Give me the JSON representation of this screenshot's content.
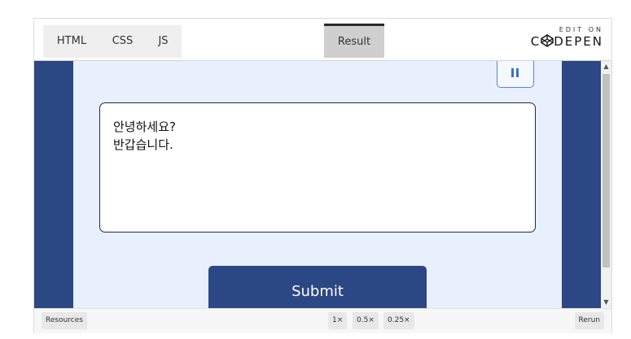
{
  "tabs": {
    "html": "HTML",
    "css": "CSS",
    "js": "JS",
    "result": "Result"
  },
  "branding": {
    "edit_on": "EDIT ON",
    "logo_text": "DEPEN",
    "logo_prefix": "C"
  },
  "result": {
    "textarea_value": "안녕하세요?\n반갑습니다.",
    "submit_label": "Submit",
    "pause_icon": "pause-icon"
  },
  "bottom": {
    "resources": "Resources",
    "zoom_1x": "1×",
    "zoom_05x": "0.5×",
    "zoom_025x": "0.25×",
    "rerun": "Rerun"
  },
  "colors": {
    "frame_blue": "#2b4784",
    "panel_bg": "#e8f0fd",
    "pause_accent": "#3b6fd0"
  }
}
